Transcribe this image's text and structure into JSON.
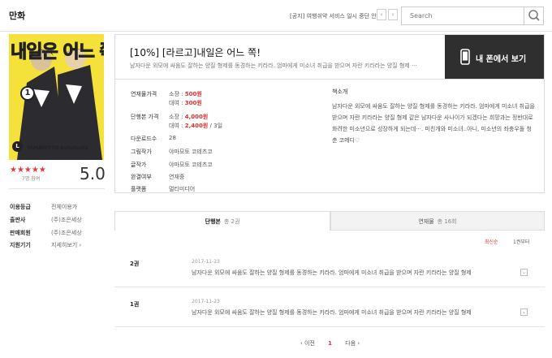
{
  "header": {
    "title": "만화",
    "notice": "[공지] 여행쉬약 서비스 일시 중단 안내",
    "prev": "‹",
    "next": "›",
    "search_placeholder": "Search"
  },
  "book": {
    "cover": {
      "title_art": "내일은 어느 쪽!",
      "volume": "1",
      "author_latin": "YAMAMOTO Kotetsuko",
      "logo_letter": "L",
      "bg_color": "#f4e23a"
    },
    "stars": "★★★★★",
    "rating_count": "7명 참여",
    "rating_score": "5.0",
    "side_info": [
      {
        "key": "이용등급",
        "value": "전체이용가"
      },
      {
        "key": "출판사",
        "value": "(주)조은세상"
      },
      {
        "key": "판매회원",
        "value": "(주)조은세상"
      },
      {
        "key": "지원기기",
        "value": "지세히보기 ›"
      }
    ],
    "title": "[10%] [라르고]내일은 어느 쪽!",
    "subtitle": "남자다운 외모에 싸움도 잘하는 양질 형제를 동경하는 키라라. 엄마에게 미소녀 취급을 받으며 자란 키라라는 양질 형제 ···",
    "phone_button": "내 폰에서 보기",
    "details": {
      "set_price_label": "연재물가격",
      "set_own_label": "소장 :",
      "set_own_price": "500원",
      "set_rent_label": "대여 :",
      "set_rent_price": "300원",
      "vol_price_label": "단행본 가격",
      "vol_own_label": "소장 :",
      "vol_own_price": "4,000원",
      "vol_rent_label": "대여 :",
      "vol_rent_price": "2,400원",
      "vol_rent_period": "/ 3일",
      "downloads_label": "다운로드수",
      "downloads": "28",
      "artist_label": "그림작가",
      "artist": "야마모토 코테츠코",
      "writer_label": "글작가",
      "writer": "야마모토 코테츠코",
      "status_label": "완결여부",
      "status": "연재중",
      "platform_label": "플랫폼",
      "platform": "멀티미디어"
    },
    "intro_title": "책소개",
    "intro": "남자다운 외모에 싸움도 잘하는 양질 형제를 동경하는 키라라. 엄마에게 미소녀 취급을 받으며 자란 키라라는 양질 형제 같은 남자다운 사나이가 되겠다는 희망과는 정반대로 화려한 미소년으로 성장하게 되는데···. 미친개와 미소녀..아니, 미소년의 좌충우돌 청춘 코메디♡"
  },
  "tabs": [
    {
      "label": "단행본",
      "count": "총 2권"
    },
    {
      "label": "연재물",
      "count": "총 16회"
    }
  ],
  "sort": {
    "active": "최신순",
    "other": "1권부터"
  },
  "episodes": [
    {
      "num": "2권",
      "date": "2017-11-23",
      "desc": "남자다운 외모에 싸움도 잘하는 양질 형제를 동경하는 키라라. 엄마에게 미소녀 취급을 받으며 자란 키라라는 양질 형제",
      "more": "⌄"
    },
    {
      "num": "1권",
      "date": "2017-11-23",
      "desc": "남자다운 외모에 싸움도 잘하는 양질 형제를 동경하는 키라라. 엄마에게 미소녀 취급을 받으며 자란 키라라는 양질 형제",
      "more": "⌄"
    }
  ],
  "pager": {
    "prev": "‹ 이전",
    "current": "1",
    "next": "다음 ›"
  }
}
